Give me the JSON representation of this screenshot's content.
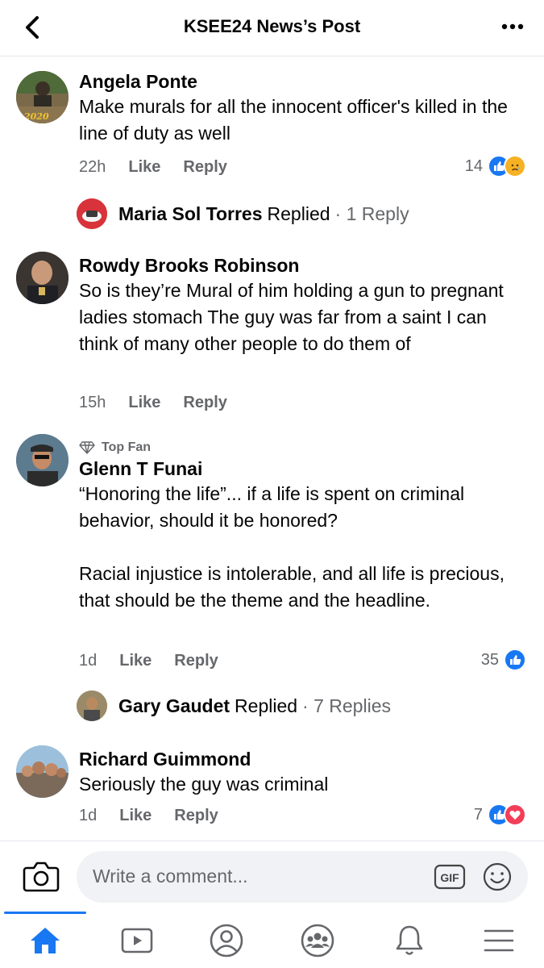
{
  "header": {
    "title": "KSEE24 News’s Post",
    "back_icon": "chevron-left-icon",
    "more_icon": "more-dots-icon"
  },
  "comments": [
    {
      "name": "Angela Ponte",
      "text": "Make murals for all the innocent officer's killed in the line of duty as well",
      "time": "22h",
      "like": "Like",
      "reply": "Reply",
      "reaction_count": "14",
      "reactions": [
        "like",
        "sad"
      ],
      "avatar_caption": "2020",
      "replied": {
        "name": "Maria Sol Torres",
        "word": "Replied",
        "count": "· 1 Reply"
      }
    },
    {
      "name": "Rowdy Brooks Robinson",
      "text": "So is they’re Mural of him holding a gun to pregnant ladies stomach The guy was far from a saint I can think of many other people to do them of",
      "time": "15h",
      "like": "Like",
      "reply": "Reply"
    },
    {
      "badge": "Top Fan",
      "name": "Glenn T Funai",
      "text": "“Honoring the life”... if a life is spent on criminal behavior, should it be honored?\n\nRacial injustice is intolerable, and all life is precious, that should be the theme and the headline.",
      "time": "1d",
      "like": "Like",
      "reply": "Reply",
      "reaction_count": "35",
      "reactions": [
        "like"
      ],
      "replied": {
        "name": "Gary Gaudet",
        "word": "Replied",
        "count": "· 7 Replies"
      }
    },
    {
      "name": "Richard Guimmond",
      "text": "Seriously the guy was criminal",
      "time": "1d",
      "like": "Like",
      "reply": "Reply",
      "reaction_count": "7",
      "reactions": [
        "like",
        "love"
      ]
    }
  ],
  "composer": {
    "placeholder": "Write a comment...",
    "gif_label": "GIF"
  },
  "tabs": [
    "home-icon",
    "watch-icon",
    "profile-icon",
    "groups-icon",
    "notifications-icon",
    "menu-icon"
  ],
  "colors": {
    "accent": "#1877f2",
    "love": "#f33e58",
    "sad": "#f7b125",
    "meta": "#65676b"
  }
}
